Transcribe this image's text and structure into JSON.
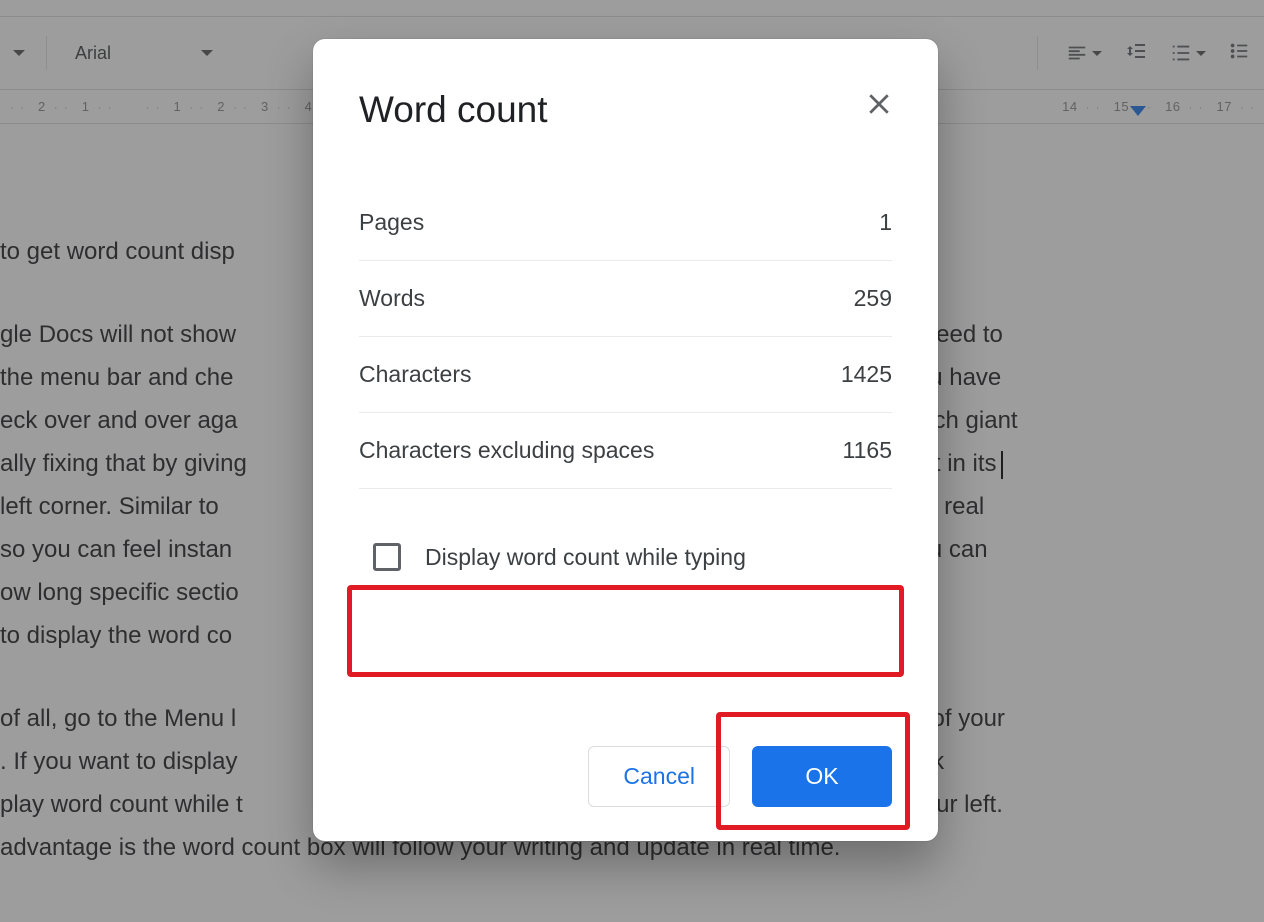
{
  "toolbar": {
    "font": "Arial"
  },
  "ruler": {
    "left_nums": [
      "2",
      "1"
    ],
    "right_nums": [
      "1",
      "2",
      "3",
      "4",
      "14",
      "15",
      "16",
      "17"
    ]
  },
  "document": {
    "line1": "to get word count disp",
    "para2_a": "gle Docs will not show ",
    "para2_a_end": "u will need to",
    "para2_b": " the menu bar and che",
    "para2_b_end": "ting you have",
    "para2_c": "eck over and over aga",
    "para2_c_end": "The tech giant",
    "para2_d": "ally fixing that by giving",
    "para2_d_end": "d count in its",
    "para2_e": " left corner. Similar to ",
    "para2_e_end": "bers in real",
    "para2_f": " so you can feel instan",
    "para2_f_end": "ther, you can",
    "para2_g": "ow long specific sectio",
    "para2_h": "to display the word co",
    "para3_a": "of all, go to the Menu l",
    "para3_a_end": "count of your",
    "para3_b": ". If you want to display",
    "para3_b_end": "o click",
    "para3_c": "play word count while t",
    "para3_c_end": "r on your left.",
    "para3_d": "advantage is the word count box will follow your writing and update in real time."
  },
  "dialog": {
    "title": "Word count",
    "rows": {
      "pages_label": "Pages",
      "pages_value": "1",
      "words_label": "Words",
      "words_value": "259",
      "chars_label": "Characters",
      "chars_value": "1425",
      "chars_ns_label": "Characters excluding spaces",
      "chars_ns_value": "1165"
    },
    "checkbox_label": "Display word count while typing",
    "cancel": "Cancel",
    "ok": "OK"
  }
}
